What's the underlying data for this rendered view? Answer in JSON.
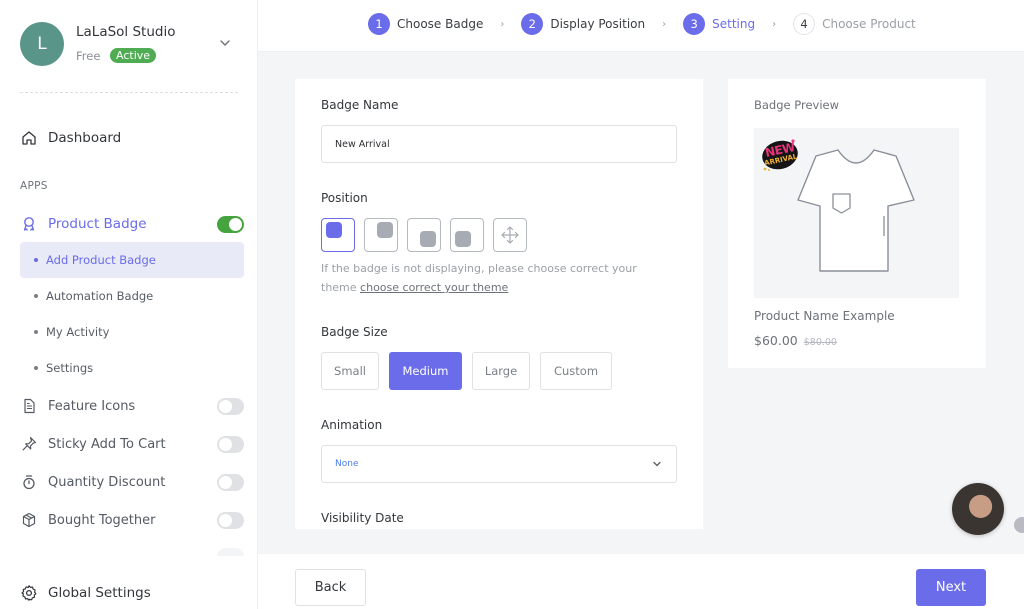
{
  "store": {
    "initial": "L",
    "name": "LaLaSol Studio",
    "plan": "Free",
    "status": "Active"
  },
  "sidebar": {
    "dashboard": "Dashboard",
    "section_label": "APPS",
    "apps": [
      {
        "label": "Product Badge",
        "icon": "badge-icon",
        "enabled": true
      },
      {
        "label": "Feature Icons",
        "icon": "document-icon",
        "enabled": false
      },
      {
        "label": "Sticky Add To Cart",
        "icon": "pin-icon",
        "enabled": false
      },
      {
        "label": "Quantity Discount",
        "icon": "stopwatch-icon",
        "enabled": false
      },
      {
        "label": "Bought Together",
        "icon": "box-icon",
        "enabled": false
      }
    ],
    "sub_items": [
      {
        "label": "Add Product Badge",
        "active": true
      },
      {
        "label": "Automation Badge",
        "active": false
      },
      {
        "label": "My Activity",
        "active": false
      },
      {
        "label": "Settings",
        "active": false
      }
    ],
    "global_settings": "Global Settings"
  },
  "stepper": {
    "steps": [
      {
        "num": "1",
        "label": "Choose Badge",
        "state": "done"
      },
      {
        "num": "2",
        "label": "Display Position",
        "state": "done"
      },
      {
        "num": "3",
        "label": "Setting",
        "state": "current"
      },
      {
        "num": "4",
        "label": "Choose Product",
        "state": "pending"
      }
    ]
  },
  "form": {
    "badge_name_label": "Badge Name",
    "badge_name_value": "New Arrival",
    "position_label": "Position",
    "position_options": [
      "top-left",
      "top-right",
      "bottom-right",
      "bottom-left",
      "custom-move"
    ],
    "position_selected": "top-left",
    "hint_text": "If the badge is not displaying, please choose correct your theme",
    "hint_link": "choose correct your theme",
    "badge_size_label": "Badge Size",
    "sizes": [
      "Small",
      "Medium",
      "Large",
      "Custom"
    ],
    "size_selected": "Medium",
    "animation_label": "Animation",
    "animation_value": "None",
    "visibility_label": "Visibility Date"
  },
  "preview": {
    "title": "Badge Preview",
    "badge_text_top": "NEW",
    "badge_text_bottom": "ARRIVAL",
    "product_name": "Product Name Example",
    "price": "$60.00",
    "old_price": "$80.00"
  },
  "footer": {
    "back": "Back",
    "next": "Next"
  },
  "colors": {
    "accent": "#6a6ce9",
    "active_green": "#4fac53",
    "toggle_on": "#45a43d"
  }
}
